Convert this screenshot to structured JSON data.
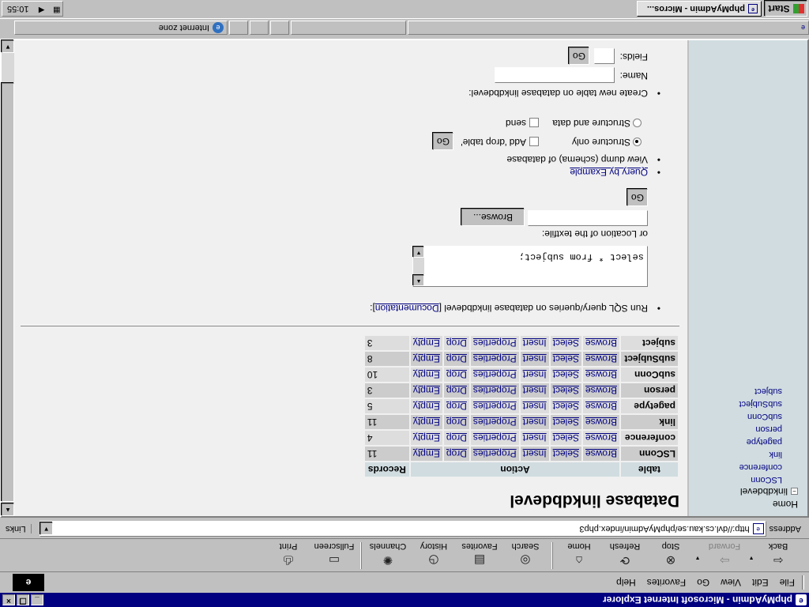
{
  "window": {
    "title": "phpMyAdmin - Microsoft Internet Explorer",
    "controls": [
      "_",
      "❐",
      "×"
    ]
  },
  "menu": [
    "File",
    "Edit",
    "View",
    "Go",
    "Favorites",
    "Help"
  ],
  "toolbar": {
    "back": "Back",
    "forward": "Forward",
    "stop": "Stop",
    "refresh": "Refresh",
    "home": "Home",
    "search": "Search",
    "favorites": "Favorites",
    "history": "History",
    "channels": "Channels",
    "fullscreen": "Fullscreen",
    "print": "Print"
  },
  "address": {
    "label": "Address",
    "url": "http://dvl.cs.kau.se/phpMyAdmin/index.php3",
    "links": "Links"
  },
  "sidebar": {
    "home": "Home",
    "database": "linkdbdevel",
    "tables": [
      "LSConn",
      "conference",
      "link",
      "pagetype",
      "person",
      "subConn",
      "subSubject",
      "subject"
    ]
  },
  "main": {
    "title": "Database linkdbdevel",
    "table": {
      "headers": {
        "table": "table",
        "action": "Action",
        "records": "Records"
      },
      "actions": [
        "Browse",
        "Select",
        "Insert",
        "Properties",
        "Drop",
        "Empty"
      ],
      "rows": [
        {
          "name": "LSConn",
          "records": "11"
        },
        {
          "name": "conference",
          "records": "4"
        },
        {
          "name": "link",
          "records": "11"
        },
        {
          "name": "pagetype",
          "records": "5"
        },
        {
          "name": "person",
          "records": "3"
        },
        {
          "name": "subConn",
          "records": "10"
        },
        {
          "name": "subSubject",
          "records": "8"
        },
        {
          "name": "subject",
          "records": "3"
        }
      ]
    },
    "sql": {
      "text_pre": "Run SQL query/queries on database linkdbdevel [",
      "doc_link": "Documentation",
      "text_post": "]:",
      "query": "select * from subject;",
      "textfile_label": "or Location of the textfile:",
      "browse": "Browse...",
      "go": "Go"
    },
    "qbe": "Query by Example",
    "dump": {
      "label": "View dump (schema) of database",
      "structure_only": "Structure only",
      "structure_and_data": "Structure and data",
      "add_drop": "Add 'drop table'",
      "send": "send",
      "go": "Go"
    },
    "create": {
      "label": "Create new table on database linkdbdevel:",
      "name_label": "Name:",
      "fields_label": "Fields:",
      "go": "Go"
    }
  },
  "status": {
    "zone": "Internet zone"
  },
  "taskbar": {
    "start": "Start",
    "task": "phpMyAdmin - Micros...",
    "clock": "10:55"
  }
}
